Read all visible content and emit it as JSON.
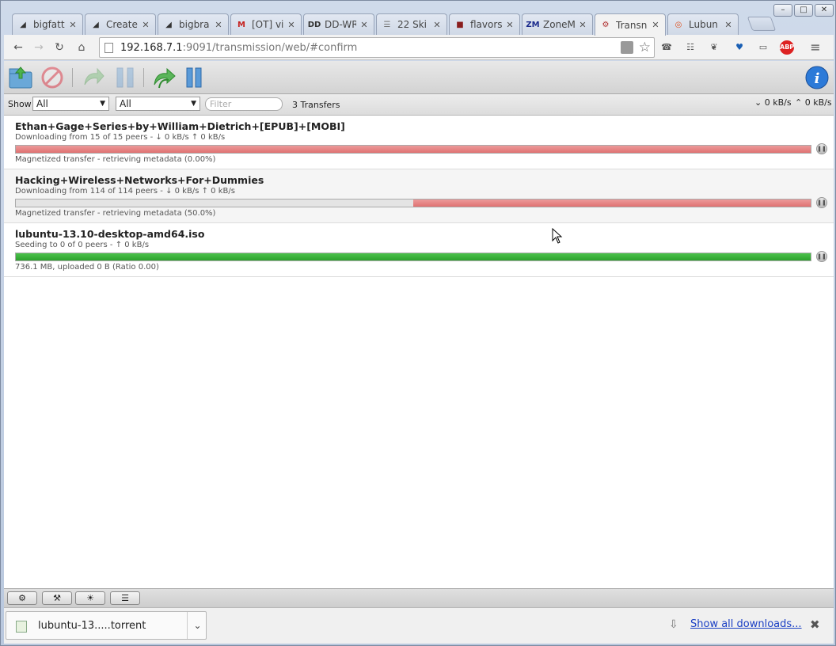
{
  "tabs": [
    {
      "title": "bigfatt",
      "icon": "shark-fin-icon",
      "color": "#333333"
    },
    {
      "title": "Create",
      "icon": "shark-fin-icon",
      "color": "#333333"
    },
    {
      "title": "bigbra",
      "icon": "shark-fin-icon",
      "color": "#333333"
    },
    {
      "title": "[OT] vi",
      "icon": "gmail-icon",
      "color": "#c5221f"
    },
    {
      "title": "DD-WR",
      "icon": "dd-wrt-icon",
      "color": "#333333"
    },
    {
      "title": "22 Ski",
      "icon": "document-icon",
      "color": "#777777"
    },
    {
      "title": "flavors",
      "icon": "flavor-icon",
      "color": "#8a1e1e"
    },
    {
      "title": "ZoneM",
      "icon": "zonem-icon",
      "color": "#1a2a8c"
    },
    {
      "title": "Transn",
      "icon": "transmission-icon",
      "color": "#b03030"
    },
    {
      "title": "Lubun",
      "icon": "ubuntu-icon",
      "color": "#e0501c"
    }
  ],
  "omnibox": {
    "host": "192.168.7.1",
    "rest": ":9091/transmission/web/#confirm"
  },
  "filterbar": {
    "show_label": "Show",
    "state_filter": "All",
    "tracker_filter": "All",
    "filter_placeholder": "Filter",
    "transfer_count": "3 Transfers",
    "download_rate": "0 kB/s",
    "upload_rate": "0 kB/s"
  },
  "torrents": [
    {
      "name": "Ethan+Gage+Series+by+William+Dietrich+[EPUB]+[MOBI]",
      "peers": "Downloading from 15 of 15 peers - ↓ 0 kB/s ↑ 0 kB/s",
      "progress_text": "Magnetized transfer - retrieving metadata (0.00%)",
      "bar_type": "magnet",
      "bar_start": 0,
      "bar_fraction": 1.0
    },
    {
      "name": "Hacking+Wireless+Networks+For+Dummies",
      "peers": "Downloading from 114 of 114 peers - ↓ 0 kB/s ↑ 0 kB/s",
      "progress_text": "Magnetized transfer - retrieving metadata (50.0%)",
      "bar_type": "magnet",
      "bar_start": 0.5,
      "bar_fraction": 0.5
    },
    {
      "name": "lubuntu-13.10-desktop-amd64.iso",
      "peers": "Seeding to 0 of 0 peers - ↑ 0 kB/s",
      "progress_text": "736.1 MB, uploaded 0 B (Ratio 0.00)",
      "bar_type": "seed",
      "bar_start": 0,
      "bar_fraction": 1.0
    }
  ],
  "download_shelf": {
    "filename": "lubuntu-13.....torrent",
    "show_all": "Show all downloads..."
  }
}
